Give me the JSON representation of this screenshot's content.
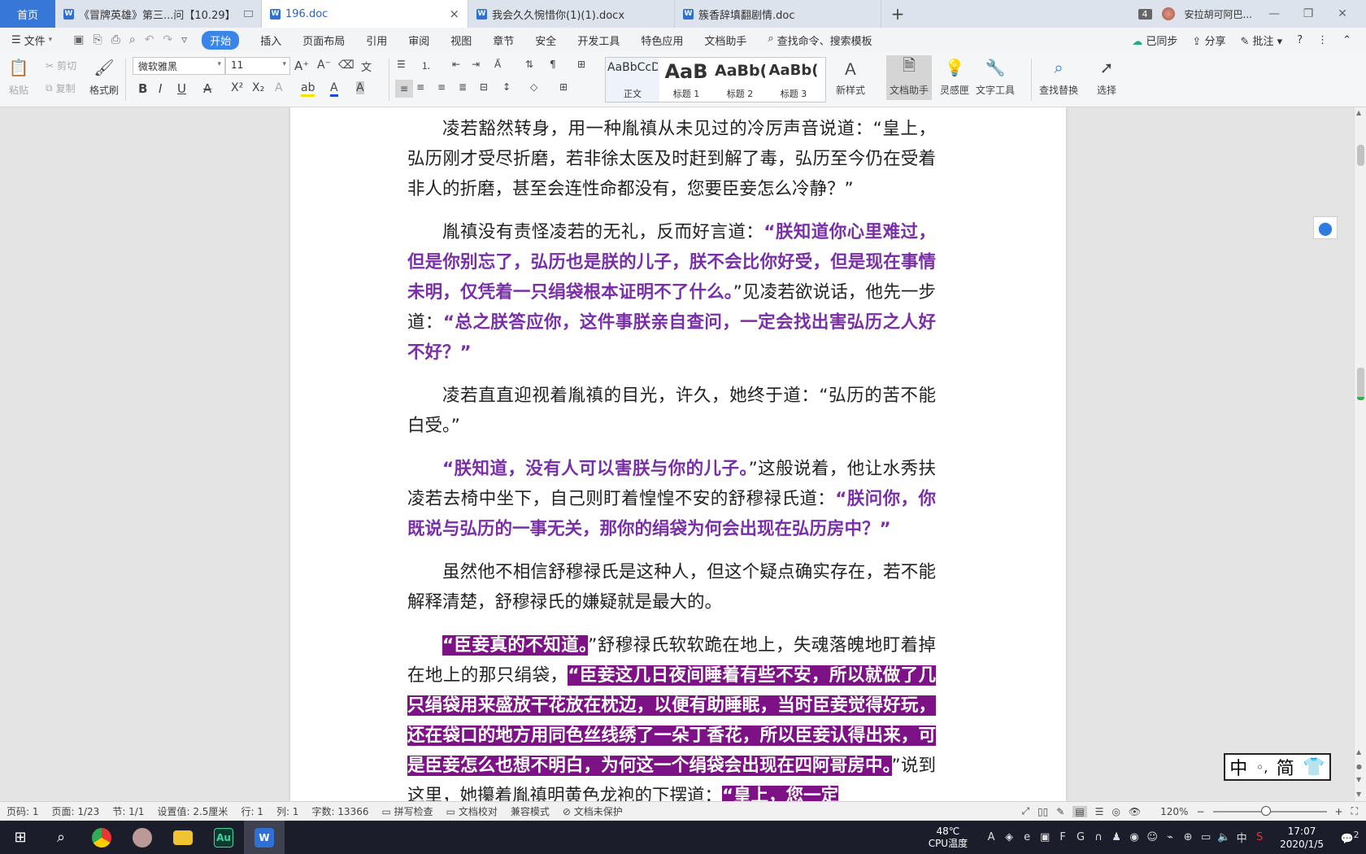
{
  "tabs": {
    "home": "首页",
    "docs": [
      {
        "title": "《冒牌英雄》第三...问【10.29】",
        "active": false
      },
      {
        "title": "196.doc",
        "active": true
      },
      {
        "title": "我会久久惋惜你(1)(1).docx",
        "active": false
      },
      {
        "title": "簇香辞填翻剧情.doc",
        "active": false
      }
    ],
    "new_tab": "+",
    "window_count": "4",
    "user_name": "安拉胡可阿巴..."
  },
  "menu": {
    "file": "文件",
    "items": [
      "开始",
      "插入",
      "页面布局",
      "引用",
      "审阅",
      "视图",
      "章节",
      "安全",
      "开发工具",
      "特色应用",
      "文档助手"
    ],
    "search": "查找命令、搜索模板",
    "synced": "已同步",
    "share": "分享",
    "comment": "批注",
    "help": "?"
  },
  "ribbon": {
    "paste": "粘贴",
    "cut": "剪切",
    "copy": "复制",
    "format_painter": "格式刷",
    "font_name": "微软雅黑",
    "font_size": "11",
    "styles": [
      {
        "preview": "AaBbCcDd",
        "name": "正文"
      },
      {
        "preview": "AaB",
        "name": "标题 1"
      },
      {
        "preview": "AaBb(",
        "name": "标题 2"
      },
      {
        "preview": "AaBb(",
        "name": "标题 3"
      }
    ],
    "new_style": "新样式",
    "doc_helper": "文档助手",
    "inspiration": "灵感匣",
    "text_tools": "文字工具",
    "find_replace": "查找替换",
    "select": "选择"
  },
  "document": {
    "paragraphs": [
      [
        {
          "t": "凌若豁然转身，用一种胤禛从未见过的冷厉声音说道：“皇上，弘历刚才受尽折磨，若非徐太医及时赶到解了毒，弘历至今仍在受着非人的折磨，甚至会连性命都没有，您要臣妾怎么冷静？”",
          "s": ""
        }
      ],
      [
        {
          "t": "胤禛没有责怪凌若的无礼，反而好言道：",
          "s": ""
        },
        {
          "t": "“朕知道你心里难过，但是你别忘了，弘历也是朕的儿子，朕不会比你好受，但是现在事情未明，仅凭着一只绢袋根本证明不了什么。",
          "s": "p"
        },
        {
          "t": "”见凌若欲说话，他先一步道：",
          "s": ""
        },
        {
          "t": "“总之朕答应你，这件事朕亲自查问，一定会找出害弘历之人好不好？”",
          "s": "p"
        }
      ],
      [
        {
          "t": "凌若直直迎视着胤禛的目光，许久，她终于道：“弘历的苦不能白受。”",
          "s": ""
        }
      ],
      [
        {
          "t": "“朕知道，没有人可以害朕与你的儿子。",
          "s": "p"
        },
        {
          "t": "”这般说着，他让水秀扶凌若去椅中坐下，自己则盯着惶惶不安的舒穆禄氏道：",
          "s": ""
        },
        {
          "t": "“朕问你，你既说与弘历的一事无关，那你的绢袋为何会出现在弘历房中？”",
          "s": "p"
        }
      ],
      [
        {
          "t": "虽然他不相信舒穆禄氏是这种人，但这个疑点确实存在，若不能解释清楚，舒穆禄氏的嫌疑就是最大的。",
          "s": ""
        }
      ],
      [
        {
          "t": "“臣妾真的不知道。",
          "s": "h"
        },
        {
          "t": "”舒穆禄氏软软跪在地上，失魂落魄地盯着掉在地上的那只绢袋，",
          "s": ""
        },
        {
          "t": "“臣妾这几日夜间睡着有些不安，所以就做了几只绢袋用来盛放干花放在枕边，以便有助睡眠，当时臣妾觉得好玩，还在袋口的地方用同色丝线绣了一朵丁香花，所以臣妾认得出来，可是臣妾怎么也想不明白，为何这一个绢袋会出现在四阿哥房中。",
          "s": "h"
        },
        {
          "t": "”说到这里，她攥着胤禛明黄色龙袍的下摆道：",
          "s": ""
        },
        {
          "t": "“皇上，您一定",
          "s": "h"
        }
      ]
    ]
  },
  "ime_box": {
    "left": "中",
    "right": "简"
  },
  "status": {
    "page_code": "页码: 1",
    "pages": "页面: 1/23",
    "section": "节: 1/1",
    "setting": "设置值: 2.5厘米",
    "row": "行: 1",
    "col": "列: 1",
    "word_count": "字数: 13366",
    "spell_check": "拼写检查",
    "proofread": "文档校对",
    "compat": "兼容模式",
    "protect": "文档未保护",
    "zoom": "120%",
    "zoom_level": 0.47
  },
  "taskbar": {
    "temperature": "48℃",
    "cpu_label": "CPU温度",
    "ime": "中",
    "time": "17:07",
    "date": "2020/1/5",
    "notifications": "2"
  }
}
